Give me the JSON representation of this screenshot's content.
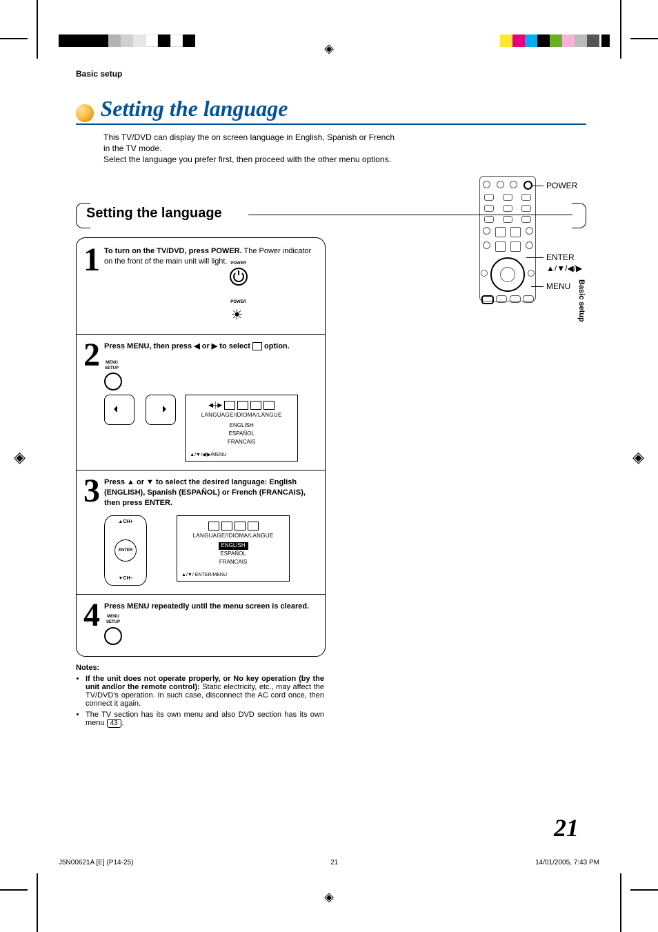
{
  "header_label": "Basic setup",
  "title": "Setting the language",
  "intro_line1": "This TV/DVD can display the on screen language in English, Spanish or French in the TV mode.",
  "intro_line2": "Select the language you prefer first, then proceed with the other menu options.",
  "remote_labels": {
    "power": "POWER",
    "enter": "ENTER",
    "arrows": "▲/▼/◀/▶",
    "menu": "MENU"
  },
  "subheading": "Setting the language",
  "step1": {
    "num": "1",
    "bold": "To turn on the TV/DVD, press POWER.",
    "rest": "The Power indicator on the front of the main unit will light.",
    "btn_label": "POWER",
    "ind_label": "POWER"
  },
  "step2": {
    "num": "2",
    "text_pre": "Press MENU, then press ◀ or ▶ to select ",
    "text_post": " option.",
    "menu_label": "MENU\nSETUP",
    "screen": {
      "title": "LANGUAGE/IDIOMA/LANGUE",
      "items": [
        "ENGLISH",
        "ESPAÑOL",
        "FRANCAIS"
      ],
      "footer": "▲/▼/◀/▶/MENU"
    }
  },
  "step3": {
    "num": "3",
    "bold": "Press ▲ or ▼ to select the desired language: English (ENGLISH), Spanish (ESPAÑOL) or French (FRANCAIS), then press ENTER.",
    "ch_up": "▲CH+",
    "ch_dn": "▼CH–",
    "enter": "ENTER",
    "screen": {
      "title": "LANGUAGE/IDIOMA/LANGUE",
      "items": [
        "ENGLISH",
        "ESPAÑOL",
        "FRANCAIS"
      ],
      "selected": 0,
      "footer": "▲/▼/ ENTER/MENU"
    }
  },
  "step4": {
    "num": "4",
    "bold": "Press MENU repeatedly until the menu screen is cleared.",
    "menu_label": "MENU\nSETUP"
  },
  "notes": {
    "heading": "Notes:",
    "n1_bold": "If the unit does not operate properly, or No key operation (by the unit and/or the remote control):",
    "n1_rest": " Static electricity, etc., may affect the TV/DVD's operation. In such case, disconnect the AC cord once, then connect it again.",
    "n2_pre": "The TV section has its own menu and also DVD section has its own menu ",
    "n2_ref": "43",
    "n2_post": "."
  },
  "side_tab": "Basic setup",
  "page_number": "21",
  "footer": {
    "left": "J5N00621A [E] (P14-25)",
    "center": "21",
    "right": "14/01/2005, 7:43 PM"
  }
}
